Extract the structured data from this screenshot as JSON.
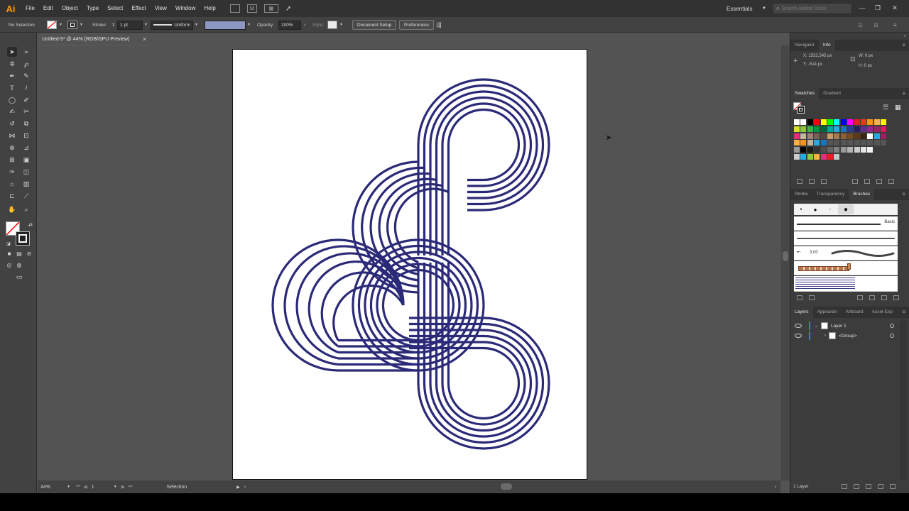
{
  "app": {
    "logo": "Ai",
    "menus": [
      "File",
      "Edit",
      "Object",
      "Type",
      "Select",
      "Effect",
      "View",
      "Window",
      "Help"
    ],
    "workspace": "Essentials",
    "search_placeholder": "Search Adobe Stock",
    "window_controls": [
      "—",
      "❐",
      "✕"
    ]
  },
  "controlbar": {
    "selection_state": "No Selection",
    "stroke_label": "Stroke:",
    "stroke_weight": "1 pt",
    "stroke_profile": "Uniform",
    "opacity_label": "Opacity:",
    "opacity_value": "100%",
    "style_label": "Style:",
    "document_setup": "Document Setup",
    "preferences": "Preferences"
  },
  "document": {
    "tab_title": "Untitled-5* @ 44% (RGB/GPU Preview)",
    "zoom": "44%",
    "artboard_number": "1",
    "status_tool": "Selection",
    "art_color": "#2b2a78"
  },
  "panels": {
    "navigator_tab": "Navigator",
    "info_tab": "Info",
    "info_x": "X: 1532,545 px",
    "info_y": "Y: -514 px",
    "info_w": "W: 0 px",
    "info_h": "H: 0 px",
    "swatches_tab": "Swatches",
    "gradient_tab": "Gradient",
    "stroke_tab": "Stroke",
    "transparency_tab": "Transparency",
    "brushes_tab": "Brushes",
    "brush_basic": "Basic",
    "brush_size": "3,00",
    "layers_tab": "Layers",
    "appearance_tab": "Appearan",
    "artboard_tab": "Artboard",
    "asset_tab": "Asset Exp",
    "layer_name": "Layer 1",
    "group_name": "<Group>",
    "layers_count": "1 Layer"
  },
  "swatch_rows": [
    [
      "#ffffff",
      "#ffffff",
      "#000000",
      "#ff0000",
      "#ffff00",
      "#00ff00",
      "#00ffff",
      "#0000ff",
      "#ff00ff",
      "#ec1c24",
      "#e8381b",
      "#f7941d",
      "#fbb040",
      "#fff200"
    ],
    [
      "#d7df23",
      "#8dc63f",
      "#39b54a",
      "#009444",
      "#006838",
      "#00a79d",
      "#27aae1",
      "#1c75bc",
      "#2b3990",
      "#262262",
      "#662d91",
      "#92278f",
      "#9e1f63",
      "#da1c5c"
    ],
    [
      "#ee2a7b",
      "#c2b59b",
      "#998675",
      "#736357",
      "#534741",
      "#c69c6d",
      "#a67c52",
      "#8c6239",
      "#754c24",
      "#603813",
      "#3c2415",
      "#ffffff",
      "#27aae1",
      "#9e1f63"
    ],
    [
      "#fbb040",
      "#f7941d",
      "#c2b59b",
      "#27aae1",
      "#1c75bc",
      "#555555",
      "#555555",
      "#555555",
      "#555555",
      "#555555",
      "#555555",
      "#555555",
      "#555555",
      "#555555"
    ],
    [
      "#999999",
      "#000000",
      "#1a1a1a",
      "#333333",
      "#4d4d4d",
      "#666666",
      "#808080",
      "#999999",
      "#b3b3b3",
      "#cccccc",
      "#e6e6e6",
      "#f2f2f2"
    ],
    [
      "#cccccc",
      "#27aae1",
      "#8dc63f",
      "#fbb040",
      "#ee2a7b",
      "#ec1c24",
      "#c7c7c7"
    ]
  ]
}
